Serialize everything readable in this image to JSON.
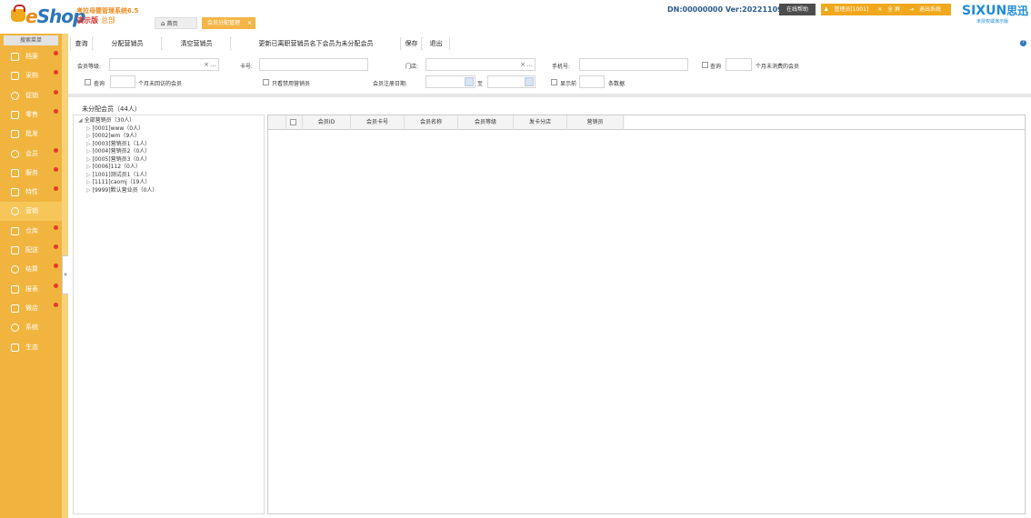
{
  "header": {
    "logo": {
      "brand_e": "e",
      "brand_rest": "Shop"
    },
    "system_name": "考拉母婴管理系统6.5",
    "demo_label": "演示版",
    "hq_label": "总部",
    "tabs": [
      {
        "label": "首页",
        "icon": "home-icon"
      },
      {
        "label": "会员分配管理",
        "close": "×"
      }
    ],
    "dn_version": "DN:00000000  Ver:20221109",
    "help_button": "在线帮助",
    "admin_label": "管理员[1001]",
    "fullscreen_label": "全 屏",
    "logout_label": "退出系统",
    "brand_right": "SIXUN",
    "brand_right_cn": "思迅",
    "unauthorized": "未授权或演示版"
  },
  "sidebar": {
    "search_menu": "搜索菜单",
    "items": [
      {
        "label": "档案",
        "icon": "archive-icon",
        "dot": true
      },
      {
        "label": "采购",
        "icon": "purchase-icon",
        "dot": true
      },
      {
        "label": "促销",
        "icon": "promotion-icon",
        "dot": true
      },
      {
        "label": "零售",
        "icon": "retail-icon",
        "dot": true
      },
      {
        "label": "批发",
        "icon": "wholesale-icon",
        "dot": false
      },
      {
        "label": "会员",
        "icon": "member-icon",
        "dot": true
      },
      {
        "label": "服务",
        "icon": "service-icon",
        "dot": true
      },
      {
        "label": "特性",
        "icon": "feature-icon",
        "dot": true
      },
      {
        "label": "营销",
        "icon": "marketing-icon",
        "dot": false,
        "active": true
      },
      {
        "label": "仓库",
        "icon": "warehouse-icon",
        "dot": true
      },
      {
        "label": "配送",
        "icon": "delivery-icon",
        "dot": true
      },
      {
        "label": "结算",
        "icon": "settlement-icon",
        "dot": true
      },
      {
        "label": "报表",
        "icon": "report-icon",
        "dot": true
      },
      {
        "label": "微店",
        "icon": "microshop-icon",
        "dot": true
      },
      {
        "label": "系统",
        "icon": "system-icon",
        "dot": false
      },
      {
        "label": "生态",
        "icon": "ecology-icon",
        "dot": false
      }
    ],
    "collapse": "«"
  },
  "toolbar": {
    "query": "查询",
    "assign_sales": "分配营销员",
    "clear_sales": "清空营销员",
    "update_resigned": "更新已离职营销员名下会员为未分配会员",
    "save": "保存",
    "exit": "退出",
    "help": "?"
  },
  "filters": {
    "member_level_label": "会员等级:",
    "member_level_value": "",
    "card_no_label": "卡号:",
    "card_no_value": "",
    "store_label": "门店:",
    "store_value": "",
    "phone_label": "手机号:",
    "phone_value": "",
    "no_consume_check_label": "查询",
    "no_consume_suffix": "个月未消费的会员",
    "no_visit_check_label": "查询",
    "no_visit_suffix": "个月未回访的会员",
    "disabled_only_label": "只看禁用营销员",
    "reg_date_label": "会员注册日期:",
    "date_to": "至",
    "show_first_label": "显示前",
    "show_suffix": "条数据"
  },
  "unassigned_label": "未分配会员（44人）",
  "tree": {
    "root": "全部营销员（30人）",
    "children": [
      "[0001]www（0人）",
      "[0002]wm（9人）",
      "[0003]营销员1（1人）",
      "[0004]营销员2（0人）",
      "[0005]营销员3（0人）",
      "[0006]112（0人）",
      "[1001]测试员1（1人）",
      "[1111]caomj（19人）",
      "[9999]默认营业员（0人）"
    ]
  },
  "grid": {
    "columns": [
      "会员ID",
      "会员卡号",
      "会员名称",
      "会员等级",
      "发卡分店",
      "营销员"
    ]
  },
  "colors": {
    "sidebar": "#f1b43e",
    "accent_orange": "#f0a81c",
    "brand_blue": "#2c76b8",
    "dot_red": "#e23a2d"
  }
}
